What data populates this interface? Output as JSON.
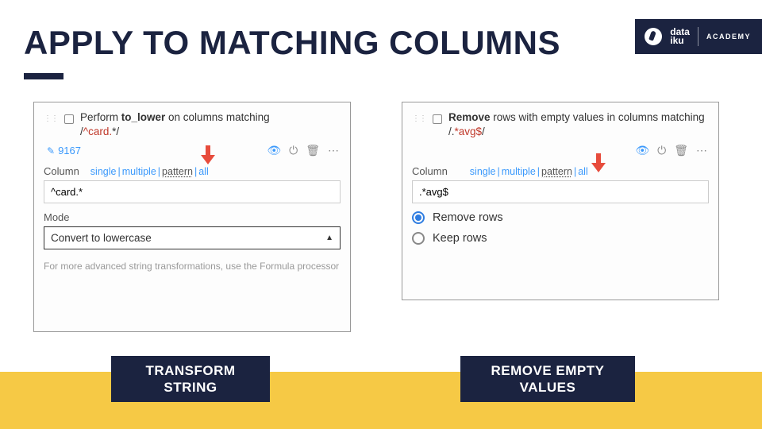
{
  "title": "APPLY TO MATCHING COLUMNS",
  "brand": {
    "line1": "data",
    "line2": "iku",
    "academy": "ACADEMY"
  },
  "left_panel": {
    "desc_pre": "Perform ",
    "desc_bold": "to_lower",
    "desc_post": " on columns matching ",
    "regex_slash1": "/",
    "regex_hl": "^card.",
    "regex_tail": "*/",
    "count": "9167",
    "column_label": "Column",
    "sel_single": "single",
    "sel_multiple": "multiple",
    "sel_pattern": "pattern",
    "sel_all": "all",
    "input_value": "^card.*",
    "mode_label": "Mode",
    "mode_value": "Convert to lowercase",
    "hint": "For more advanced string transformations, use the Formula processor",
    "caption_l1": "TRANSFORM",
    "caption_l2": "STRING"
  },
  "right_panel": {
    "desc_bold": "Remove",
    "desc_post": " rows with empty values in columns matching /.",
    "regex_hl": "*avg$",
    "regex_tail": "/",
    "column_label": "Column",
    "sel_single": "single",
    "sel_multiple": "multiple",
    "sel_pattern": "pattern",
    "sel_all": "all",
    "input_value": ".*avg$",
    "radio_remove": "Remove rows",
    "radio_keep": "Keep rows",
    "caption_l1": "REMOVE EMPTY",
    "caption_l2": "VALUES"
  }
}
